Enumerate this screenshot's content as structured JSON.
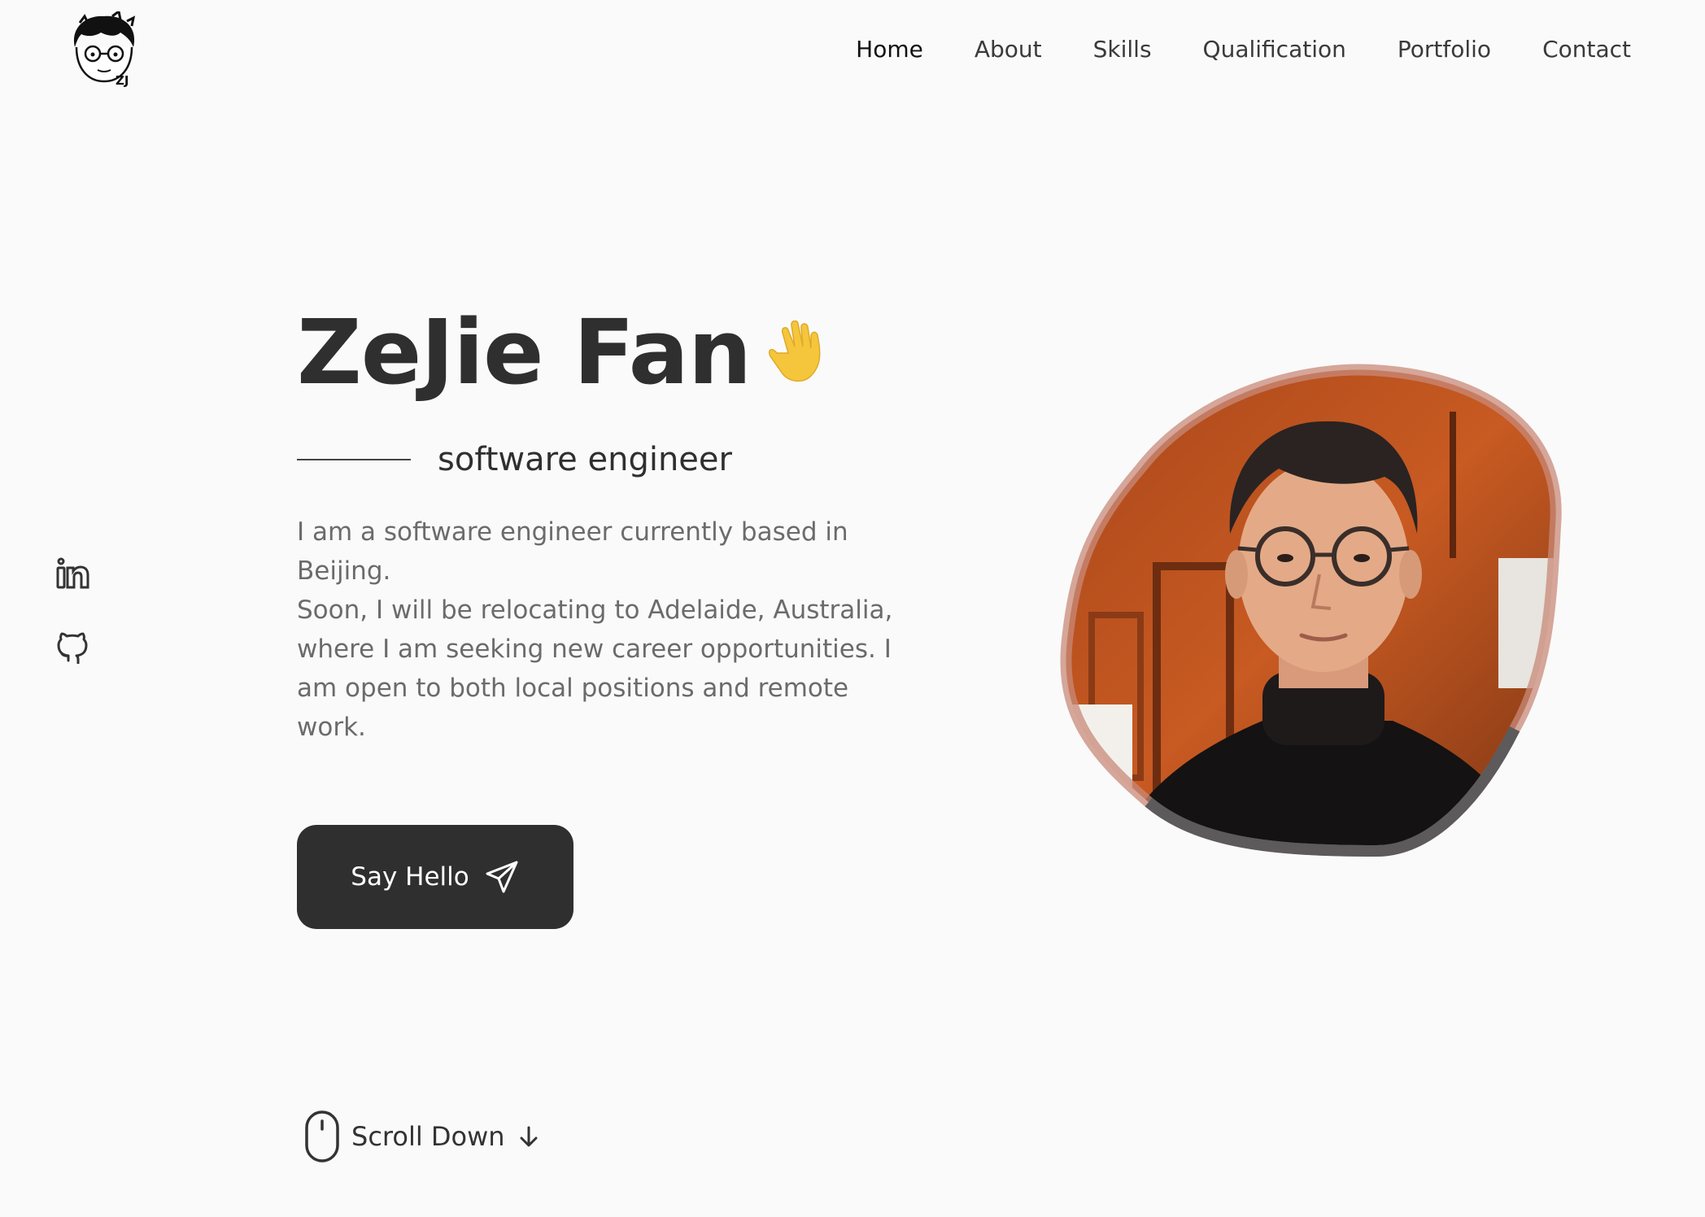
{
  "header": {
    "logo_text": "ZJ",
    "nav": [
      {
        "label": "Home",
        "active": true
      },
      {
        "label": "About"
      },
      {
        "label": "Skills"
      },
      {
        "label": "Qualification"
      },
      {
        "label": "Portfolio"
      },
      {
        "label": "Contact"
      }
    ]
  },
  "social": [
    {
      "icon": "linkedin-icon"
    },
    {
      "icon": "github-icon"
    }
  ],
  "hero": {
    "name": "ZeJie Fan",
    "wave_icon": "waving-hand-icon",
    "subtitle": "software engineer",
    "description": "I am a software engineer currently based in Beijing.\nSoon, I will be relocating to Adelaide, Australia, where I am seeking new career opportunities. I am open to both local positions and remote work.",
    "cta_label": "Say Hello",
    "cta_icon": "send-icon",
    "scroll_label": "Scroll Down",
    "scroll_icons": [
      "mouse-icon",
      "arrow-down-icon"
    ]
  },
  "colors": {
    "background": "#fafafa",
    "text_dark": "#2f2f2f",
    "text_muted": "#6b6b6b",
    "button_bg": "#2f2f2f",
    "wave_yellow": "#f5c63b"
  }
}
